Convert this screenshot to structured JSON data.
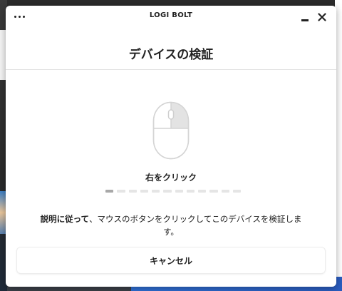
{
  "window": {
    "app_title": "LOGI BOLT"
  },
  "header": {
    "title": "デバイスの検証"
  },
  "step": {
    "action_label": "右をクリック",
    "progress_segments": 12,
    "progress_current": 1
  },
  "instruction": {
    "bold_part": "説明に従って",
    "rest": "、マウスのボタンをクリックしてこのデバイスを検証します。"
  },
  "footer": {
    "cancel_label": "キャンセル"
  },
  "colors": {
    "highlight_button": "#e3e3e3",
    "progress_active": "#a8a8a8",
    "progress_inactive": "#e5e5e5"
  },
  "icons": {
    "menu": "more-horizontal-icon",
    "minimize": "minimize-icon",
    "close": "close-icon",
    "mouse": "mouse-right-click-icon"
  }
}
